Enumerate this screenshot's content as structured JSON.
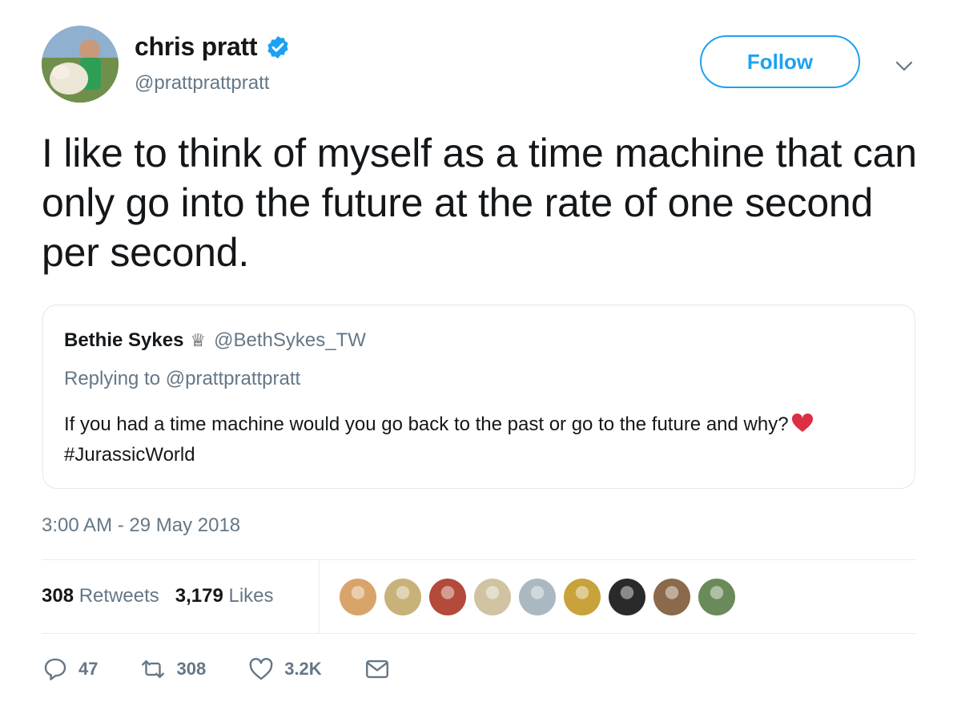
{
  "author": {
    "display_name": "chris pratt",
    "handle": "@prattprattpratt",
    "verified_icon": "verified-badge-icon"
  },
  "header": {
    "follow_label": "Follow",
    "menu_icon": "chevron-down-icon"
  },
  "tweet": {
    "text": "I like to think of myself as a time machine that can only go into the future at the rate of one second per second."
  },
  "quote": {
    "name": "Bethie Sykes",
    "name_emoji": "♕",
    "handle": "@BethSykes_TW",
    "replying_prefix": "Replying to",
    "replying_to": "@prattprattpratt",
    "text_before": "If you had a time machine would you go back to the past or go to the future and why?",
    "hashtag": "#JurassicWorld"
  },
  "timestamp": "3:00 AM - 29 May 2018",
  "stats": {
    "retweets_count": "308",
    "retweets_label": "Retweets",
    "likes_count": "3,179",
    "likes_label": "Likes"
  },
  "likers": [
    {
      "color": "#d9a46a"
    },
    {
      "color": "#c9b27a"
    },
    {
      "color": "#b34a3a"
    },
    {
      "color": "#cfc3a2"
    },
    {
      "color": "#aab8c2"
    },
    {
      "color": "#c8a23a"
    },
    {
      "color": "#2a2a2a"
    },
    {
      "color": "#8a6a4a"
    },
    {
      "color": "#6a8a5a"
    }
  ],
  "actions": {
    "reply_count": "47",
    "retweet_count": "308",
    "like_count": "3.2K"
  },
  "colors": {
    "accent": "#1da1f2",
    "secondary_text": "#657786",
    "heart": "#e0245e"
  }
}
